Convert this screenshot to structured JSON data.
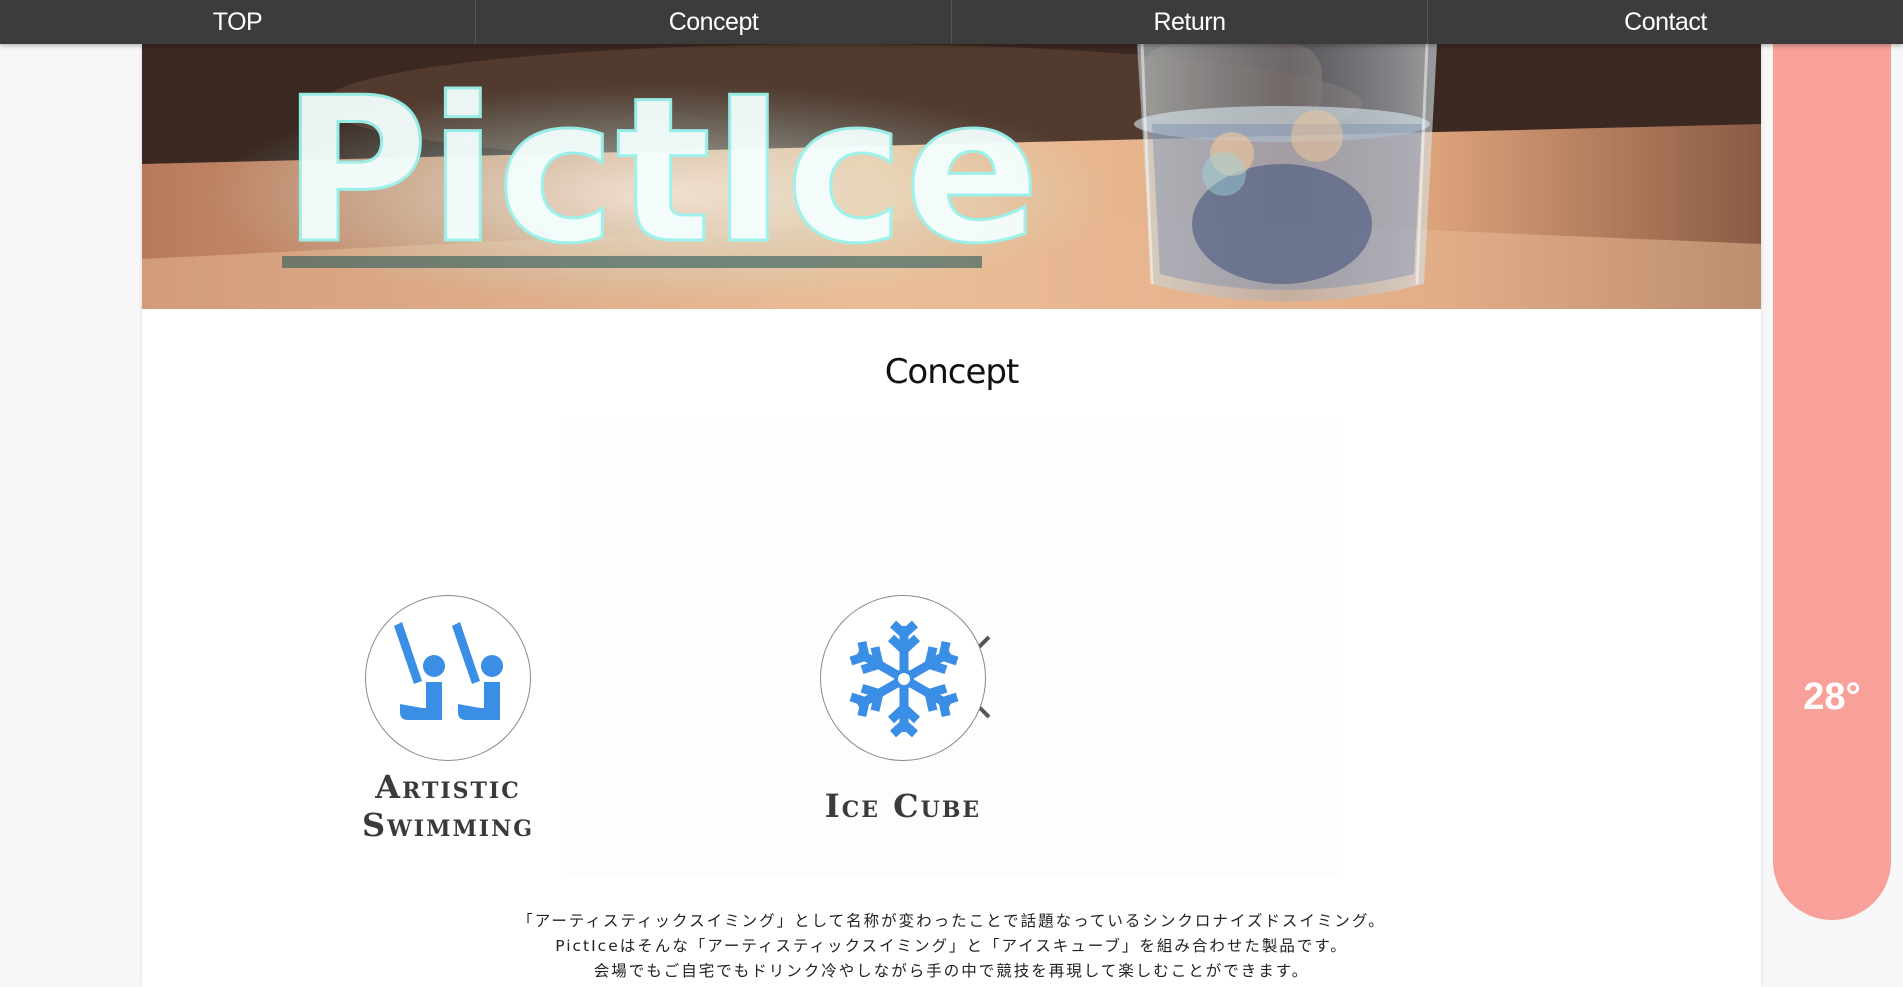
{
  "nav": {
    "items": [
      "TOP",
      "Concept",
      "Return",
      "Contact"
    ]
  },
  "hero": {
    "logo_text": "PictIce"
  },
  "concept": {
    "title": "Concept",
    "left_label_line1": "Artistic",
    "left_label_line2": "Swimming",
    "right_label": "Ice Cube",
    "description": [
      "「アーティスティックスイミング」として名称が変わったことで話題なっているシンクロナイズドスイミング。",
      "PictIceはそんな「アーティスティックスイミング」と「アイスキューブ」を組み合わせた製品です。",
      "会場でもご自宅でもドリンク冷やしながら手の中で競技を再現して楽しむことができます。"
    ]
  },
  "temperature": {
    "value": "28°"
  },
  "colors": {
    "nav_bg": "#3c3c3c",
    "icon_blue": "#3a8ee6",
    "thermo": "#f8a09a"
  },
  "icons": [
    "artistic-swimming-icon",
    "snowflake-icon",
    "times-icon"
  ]
}
